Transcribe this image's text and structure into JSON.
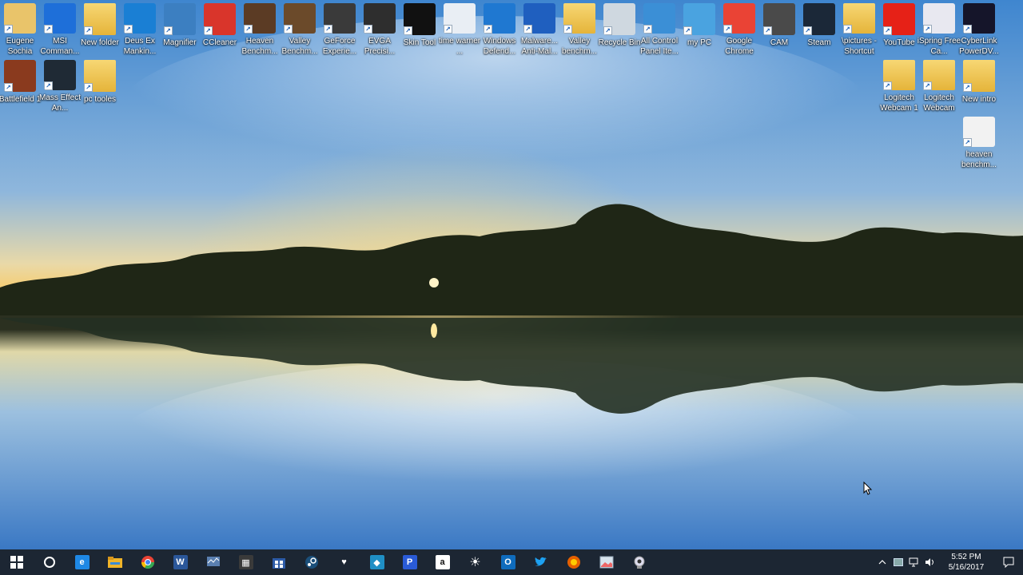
{
  "desktop": {
    "icons": [
      {
        "label": "Eugene Sochia",
        "icon": "user-folder-icon",
        "color": "#e9c46a"
      },
      {
        "label": "MSI Comman...",
        "icon": "msi-command-center-icon",
        "color": "#1e6fd9"
      },
      {
        "label": "New folder",
        "icon": "folder-icon",
        "color": "#e5b43a"
      },
      {
        "label": "Deus Ex Mankin...",
        "icon": "deus-ex-gear-icon",
        "color": "#1a7fd4"
      },
      {
        "label": "Magnifier",
        "icon": "magnifier-icon",
        "color": "#3c7fc1"
      },
      {
        "label": "CCleaner",
        "icon": "ccleaner-icon",
        "color": "#d9352b"
      },
      {
        "label": "Heaven Benchm...",
        "icon": "heaven-benchmark-icon",
        "color": "#5b3b24"
      },
      {
        "label": "Valley Benchm...",
        "icon": "valley-benchmark-icon",
        "color": "#6b4a2a"
      },
      {
        "label": "GeForce Experie...",
        "icon": "geforce-experience-icon",
        "color": "#3a3a3a"
      },
      {
        "label": "EVGA Precisi...",
        "icon": "evga-precision-icon",
        "color": "#2e2e2e"
      },
      {
        "label": "Skin Tool",
        "icon": "skin-tool-icon",
        "color": "#111111"
      },
      {
        "label": "time warner ...",
        "icon": "document-icon",
        "color": "#e9eef4"
      },
      {
        "label": "Windows Defend...",
        "icon": "windows-defender-icon",
        "color": "#1f78d1"
      },
      {
        "label": "Malware... Anti-Mal...",
        "icon": "malwarebytes-icon",
        "color": "#1f5fbf"
      },
      {
        "label": "Valley benchm...",
        "icon": "folder-icon",
        "color": "#e5b43a"
      },
      {
        "label": "Recycle Bin",
        "icon": "recycle-bin-icon",
        "color": "#cfd8e0"
      },
      {
        "label": "All Control Panel Ite...",
        "icon": "control-panel-icon",
        "color": "#3b8fd6"
      },
      {
        "label": "my PC",
        "icon": "computer-icon",
        "color": "#4aa3e0"
      },
      {
        "label": "Google Chrome",
        "icon": "chrome-icon",
        "color": "#ea4335"
      },
      {
        "label": "CAM",
        "icon": "nzxt-cam-icon",
        "color": "#4a4a4a"
      },
      {
        "label": "Steam",
        "icon": "steam-icon",
        "color": "#1b2838"
      },
      {
        "label": "\\pictures - Shortcut",
        "icon": "folder-icon",
        "color": "#e5b43a"
      },
      {
        "label": "YouTube",
        "icon": "youtube-icon",
        "color": "#e62117"
      },
      {
        "label": "iSpring Free Ca...",
        "icon": "ispring-icon",
        "color": "#e8e8f0"
      },
      {
        "label": "CyberLink PowerDV...",
        "icon": "powerdvd-icon",
        "color": "#15152a"
      },
      {
        "label": "Battlefield 1",
        "icon": "battlefield-icon",
        "color": "#8a3a1e"
      },
      {
        "label": "Mass Effect An...",
        "icon": "mass-effect-icon",
        "color": "#1f2a35"
      },
      {
        "label": "pc tooles",
        "icon": "folder-icon",
        "color": "#e5b43a"
      },
      {
        "label": "Logitech Webcam 1",
        "icon": "folder-icon",
        "color": "#e5b43a"
      },
      {
        "label": "Logitech Webcam",
        "icon": "folder-icon",
        "color": "#e5b43a"
      },
      {
        "label": "New intro",
        "icon": "folder-icon",
        "color": "#e5b43a"
      },
      {
        "label": "heaven benchm...",
        "icon": "chrome-icon",
        "color": "#f2f2f2"
      }
    ]
  },
  "taskbar": {
    "items": [
      {
        "name": "start-button",
        "icon": "windows-logo-icon",
        "glyph": "",
        "color": "#ffffff"
      },
      {
        "name": "cortana-button",
        "icon": "cortana-circle-icon",
        "glyph": "",
        "color": "#ffffff"
      },
      {
        "name": "edge-button",
        "icon": "edge-icon",
        "glyph": "e",
        "color": "#1e88e5"
      },
      {
        "name": "file-explorer-button",
        "icon": "file-explorer-icon",
        "glyph": "",
        "color": "#f0b429"
      },
      {
        "name": "chrome-button",
        "icon": "chrome-icon",
        "glyph": "",
        "color": "#ea4335"
      },
      {
        "name": "word-button",
        "icon": "word-icon",
        "glyph": "W",
        "color": "#2b579a"
      },
      {
        "name": "task-manager-button",
        "icon": "task-manager-icon",
        "glyph": "",
        "color": "#5a7fb0"
      },
      {
        "name": "calculator-button",
        "icon": "calculator-icon",
        "glyph": "▦",
        "color": "#3a3a3a"
      },
      {
        "name": "store-button",
        "icon": "store-icon",
        "glyph": "",
        "color": "#2d5ba8"
      },
      {
        "name": "steam-button",
        "icon": "steam-icon",
        "glyph": "",
        "color": "#1b4f7a"
      },
      {
        "name": "iheartradio-button",
        "icon": "iheartradio-icon",
        "glyph": "♥",
        "color": "#1c2633"
      },
      {
        "name": "kodi-button",
        "icon": "kodi-icon",
        "glyph": "◆",
        "color": "#1f8fc5"
      },
      {
        "name": "pandora-button",
        "icon": "pandora-icon",
        "glyph": "P",
        "color": "#2a5bd7"
      },
      {
        "name": "amazon-button",
        "icon": "amazon-icon",
        "glyph": "a",
        "color": "#ffffff"
      },
      {
        "name": "brightness-button",
        "icon": "sun-icon",
        "glyph": "☀",
        "color": "#1c2633"
      },
      {
        "name": "outlook-button",
        "icon": "outlook-icon",
        "glyph": "O",
        "color": "#0f6cbd"
      },
      {
        "name": "twitter-button",
        "icon": "twitter-icon",
        "glyph": "",
        "color": "#1c2633"
      },
      {
        "name": "firefox-button",
        "icon": "firefox-icon",
        "glyph": "",
        "color": "#e66000"
      },
      {
        "name": "image-viewer-button",
        "icon": "image-viewer-icon",
        "glyph": "",
        "color": "#d8e4ee"
      },
      {
        "name": "webcam-button",
        "icon": "webcam-icon",
        "glyph": "",
        "color": "#1c2633"
      }
    ],
    "tray": {
      "chevron_icon": "chevron-up-icon",
      "time": "5:52 PM",
      "date": "5/16/2017"
    }
  }
}
